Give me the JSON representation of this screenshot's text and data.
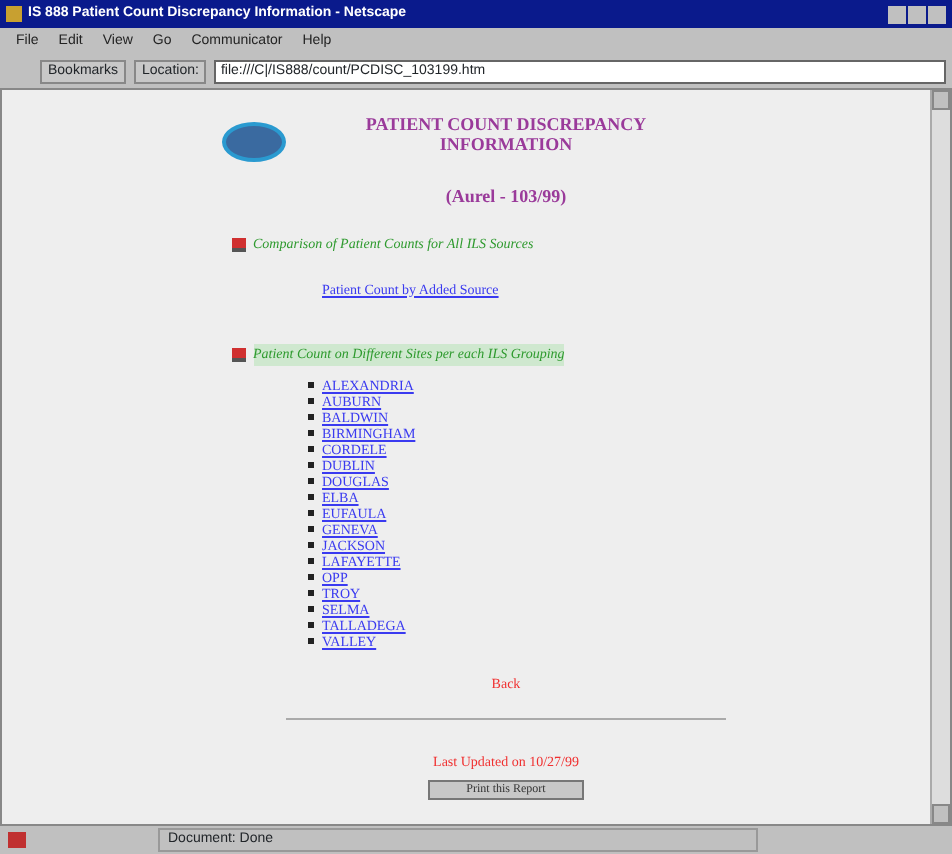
{
  "window": {
    "title": "IS 888 Patient Count Discrepancy Information - Netscape"
  },
  "menu": [
    "File",
    "Edit",
    "View",
    "Go",
    "Communicator",
    "Help"
  ],
  "toolbar": {
    "bookmarks": "Bookmarks",
    "location_label": "Location:",
    "url": "file:///C|/IS888/count/PCDISC_103199.htm"
  },
  "page": {
    "heading": [
      "PATIENT COUNT DISCREPANCY",
      "INFORMATION"
    ],
    "subheading": "(Aurel - 103/99)",
    "sections": [
      {
        "title": "Comparison of Patient Counts for All ILS Sources",
        "links": [
          "Patient Count by Added Source"
        ],
        "kind": "plain"
      },
      {
        "title": "Patient Count on Different Sites per each ILS Grouping",
        "kind": "bulleted",
        "links": [
          "ALEXANDRIA",
          "AUBURN",
          "BALDWIN",
          "BIRMINGHAM",
          "CORDELE",
          "DUBLIN",
          "DOUGLAS",
          "ELBA",
          "EUFAULA",
          "GENEVA",
          "JACKSON",
          "LAFAYETTE",
          "OPP",
          "TROY",
          "SELMA",
          "TALLADEGA",
          "VALLEY"
        ]
      }
    ],
    "back": "Back",
    "updated": "Last Updated on 10/27/99",
    "button": "Print this Report"
  },
  "status_bar": {
    "text": "Document: Done"
  }
}
